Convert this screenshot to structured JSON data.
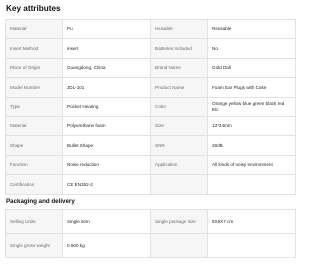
{
  "key_attributes": {
    "title": "Key attributes",
    "rows": [
      {
        "k1": "Material",
        "v1": "Pu",
        "k2": "reusable",
        "v2": "Reusable"
      },
      {
        "k1": "Insert Method",
        "v1": "insert",
        "k2": "Batteries Included",
        "v2": "No"
      },
      {
        "k1": "Place of Origin",
        "v1": "Guangdong, China",
        "k2": "Brand Name",
        "v2": "Gold Dall"
      },
      {
        "k1": "Model Number",
        "v1": "JDL-101",
        "k2": "Product Name",
        "v2": "Foam Ear Plugs with Case"
      },
      {
        "k1": "Type",
        "v1": "Pocket Hearing",
        "k2": "Color",
        "v2": "Orange yellow blue green black red Etc"
      },
      {
        "k1": "Material",
        "v1": "Polyurethane foam",
        "k2": "Size",
        "v2": "13*24mm"
      },
      {
        "k1": "Shape",
        "v1": "Bullet Shape",
        "k2": "SNR",
        "v2": "28dB"
      },
      {
        "k1": "Function",
        "v1": "Noise reduction",
        "k2": "Application",
        "v2": "All kinds of noisy environment"
      },
      {
        "k1": "Certification",
        "v1": "CE EN352-2",
        "k2": "",
        "v2": ""
      }
    ]
  },
  "packaging": {
    "title": "Packaging and delivery",
    "rows": [
      {
        "k1": "Selling Units",
        "v1": "Single item",
        "k2": "Single package size",
        "v2": "5X6X7 cm"
      },
      {
        "k1": "Single gross weight",
        "v1": "0.500 kg",
        "k2": "",
        "v2": ""
      }
    ]
  }
}
